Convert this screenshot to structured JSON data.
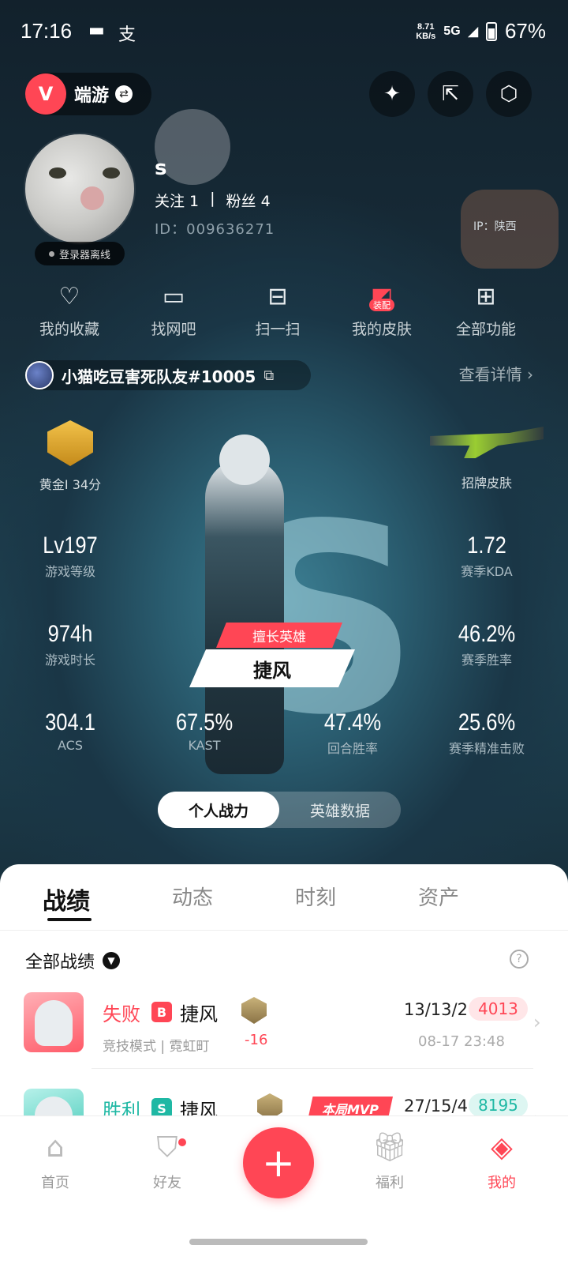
{
  "status": {
    "time": "17:16",
    "net_speed_value": "8.71",
    "net_speed_unit": "KB/s",
    "network": "5G",
    "battery": "67%"
  },
  "header": {
    "game_name": "端游",
    "logo_letter": "V",
    "accent_color": "#ff4655"
  },
  "profile": {
    "nickname": "s",
    "follow_label": "关注 1",
    "fans_label": "粉丝 4",
    "uid": "ID：009636271",
    "online_status": "登录器离线",
    "ip_label": "IP：陕西"
  },
  "functions": [
    {
      "label": "我的收藏",
      "icon": "heart-icon"
    },
    {
      "label": "找网吧",
      "icon": "monitor-icon"
    },
    {
      "label": "扫一扫",
      "icon": "scan-icon"
    },
    {
      "label": "我的皮肤",
      "icon": "skin-icon",
      "tag": "装配"
    },
    {
      "label": "全部功能",
      "icon": "grid-icon"
    }
  ],
  "riot": {
    "id": "小猫吃豆害死队友#10005",
    "detail_link": "查看详情"
  },
  "stats": {
    "rank_label": "黄金I 34分",
    "showcase_label": "招牌皮肤",
    "level": {
      "value": "Lv197",
      "label": "游戏等级"
    },
    "kda": {
      "value": "1.72",
      "label": "赛季KDA"
    },
    "playtime": {
      "value": "974h",
      "label": "游戏时长"
    },
    "winrate": {
      "value": "46.2%",
      "label": "赛季胜率"
    },
    "acs": {
      "value": "304.1",
      "label": "ACS"
    },
    "kast": {
      "value": "67.5%",
      "label": "KAST"
    },
    "round_winrate": {
      "value": "47.4%",
      "label": "回合胜率"
    },
    "headshot": {
      "value": "25.6%",
      "label": "赛季精准击败"
    }
  },
  "good_agent": {
    "tag": "擅长英雄",
    "name": "捷风"
  },
  "toggle": {
    "personal": "个人战力",
    "hero": "英雄数据"
  },
  "tabs": [
    "战绩",
    "动态",
    "时刻",
    "资产"
  ],
  "records": {
    "filter_label": "全部战绩",
    "help": "?",
    "matches": [
      {
        "result": "失败",
        "mode_badge": "B",
        "agent": "捷风",
        "mode_map": "竞技模式 | 霓虹町",
        "rank_delta": "-16",
        "kda": "13/13/2",
        "score": "4013",
        "time": "08-17 23:48"
      },
      {
        "result": "胜利",
        "mode_badge": "S",
        "agent": "捷风",
        "mvp": "本局MVP",
        "kda": "27/15/4",
        "score": "8195"
      }
    ]
  },
  "bottom_nav": {
    "home": "首页",
    "friends": "好友",
    "fab": "+",
    "welfare": "福利",
    "mine": "我的"
  }
}
